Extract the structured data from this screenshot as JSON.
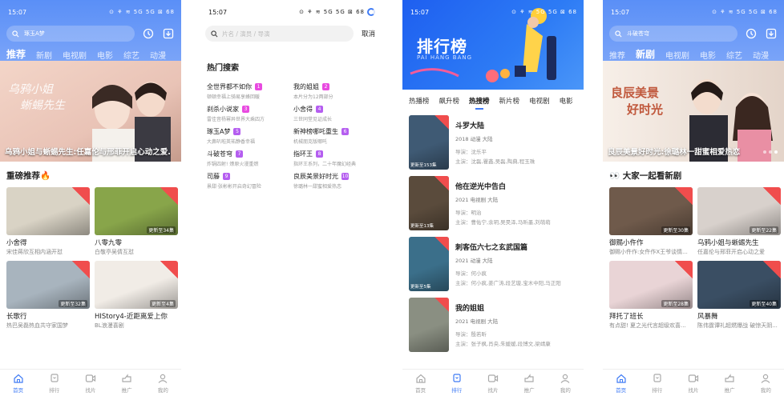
{
  "status": {
    "time": "15:07",
    "icons": "⊙ ⚘ ≋ 5G 5G ⊠ 68"
  },
  "bottom_nav": [
    {
      "label": "首页",
      "icon": "home-icon"
    },
    {
      "label": "排行",
      "icon": "trophy-icon"
    },
    {
      "label": "找片",
      "icon": "video-icon"
    },
    {
      "label": "推广",
      "icon": "share-icon"
    },
    {
      "label": "我的",
      "icon": "user-icon"
    }
  ],
  "p1": {
    "search": "琢玉A梦",
    "tabs": [
      "推荐",
      "新剧",
      "电视剧",
      "电影",
      "综艺",
      "动漫"
    ],
    "banner_caption": "乌鸦小姐与蜥蜴先生:任嘉伦与邢菲开启心动之爱.",
    "section_title": "重磅推荐🔥",
    "cards": [
      {
        "title": "小舍得",
        "desc": "宋佳蒋欣互相内涵开怼",
        "ep": "",
        "bg": "#d9d3c5"
      },
      {
        "title": "八零九零",
        "desc": "白敬亭吴倩互怼",
        "ep": "更新至34集",
        "bg": "#88a54a"
      },
      {
        "title": "长歌行",
        "desc": "热巴吴磊热血共守家国梦",
        "ep": "更新至32集",
        "bg": "#a8b4be"
      },
      {
        "title": "HIStory4-近距离爱上你",
        "desc": "BL浪漫喜剧",
        "ep": "更新至4集",
        "bg": "#f1ece6"
      }
    ]
  },
  "p2": {
    "placeholder": "片名 / 演员 / 导演",
    "cancel": "取消",
    "hot_title": "热门搜索",
    "items": [
      {
        "name": "全世界都不如你",
        "sub": "顿顿幸福上骑易享蜂回暖",
        "rank": "1",
        "color": "#e84ae0"
      },
      {
        "name": "我的姐姐",
        "sub": "本片分为12两部分",
        "rank": "2",
        "color": "#e84ae0"
      },
      {
        "name": "刹杀小说家",
        "sub": "雷佳音杨幂异世界大乘四方",
        "rank": "3",
        "color": "#e84ae0"
      },
      {
        "name": "小舍得",
        "sub": "三世同堂见证成长",
        "rank": "4",
        "color": "#b55ef0"
      },
      {
        "name": "琢玉A梦",
        "sub": "大鼻叭啦英祐静香幸福",
        "rank": "5",
        "color": "#b55ef0"
      },
      {
        "name": "新神榜哪吒重生",
        "sub": "机械朋克版哪吒",
        "rank": "6",
        "color": "#b55ef0"
      },
      {
        "name": "斗破苍穹",
        "sub": "炸锅四射! 燎原火漫重燃",
        "rank": "7",
        "color": "#b55ef0"
      },
      {
        "name": "指环王",
        "sub": "指环王系列，二十年魔幻经典",
        "rank": "8",
        "color": "#b55ef0"
      },
      {
        "name": "司藤",
        "sub": "景甜·张彬彬开启奇幻冒险",
        "rank": "9",
        "color": "#b55ef0"
      },
      {
        "name": "良辰美景好时光",
        "sub": "徐璐林一甜蜜相爱热恋",
        "rank": "10",
        "color": "#b55ef0"
      }
    ]
  },
  "p3": {
    "title": "排行榜",
    "subtitle": "PAI HANG BANG",
    "tabs": [
      "热播榜",
      "飙升榜",
      "热搜榜",
      "新片榜",
      "电视剧",
      "电影"
    ],
    "rows": [
      {
        "title": "斗罗大陆",
        "meta": "2018  动漫  大陆",
        "dir": "导演：沈乐平",
        "cast": "主演：沈磊,瞿鑫,吴磊,陶典,程玉珠",
        "ep": "更新至153集",
        "bg": "#3f5a74"
      },
      {
        "title": "他在逆光中告白",
        "meta": "2021  电视剧  大陆",
        "dir": "导演：明治",
        "cast": "主演：曹佑宁,余玥,吴昊泽,马昕墨,刘萌萌",
        "ep": "更新至13集",
        "bg": "#5a4b3c"
      },
      {
        "title": "刺客伍六七之玄武国篇",
        "meta": "2021  动漫  大陆",
        "dir": "导演：何小疯",
        "cast": "主演：何小疯,姜广涛,段艺璇,宝木中阳,马正阳",
        "ep": "更新至5集",
        "bg": "#3b6f8a"
      },
      {
        "title": "我的姐姐",
        "meta": "2021  电视剧  大陆",
        "dir": "导演：殷若昕",
        "cast": "主演：张子枫,肖央,朱媛媛,段博文,梁靖康",
        "ep": "",
        "bg": "#8a8f82"
      }
    ]
  },
  "p4": {
    "search": "斗破苍穹",
    "tabs": [
      "推荐",
      "新剧",
      "电视剧",
      "电影",
      "综艺",
      "动漫"
    ],
    "banner_caption": "良辰美景好时光:徐璐林一甜蜜相爱热恋",
    "section_title": "👀 大家一起看新剧",
    "cards": [
      {
        "title": "御赐小仵作",
        "desc": "御赐小仵作:女仵作X王爷谈情...",
        "ep": "更新至30集",
        "bg": "#6f5a4b"
      },
      {
        "title": "乌鸦小姐与蜥蜴先生",
        "desc": "任嘉伦与邢菲开启心动之爱",
        "ep": "更新至22集",
        "bg": "#d8d1cc"
      },
      {
        "title": "拜托了班长",
        "desc": "有点甜! 夏之光代言超级欢喜...",
        "ep": "更新至28集",
        "bg": "#e9d4d6"
      },
      {
        "title": "风暴舞",
        "desc": "陈伟霆谭礼超燃爆战 破惊天阴...",
        "ep": "更新至40集",
        "bg": "#3a4e63"
      }
    ]
  }
}
